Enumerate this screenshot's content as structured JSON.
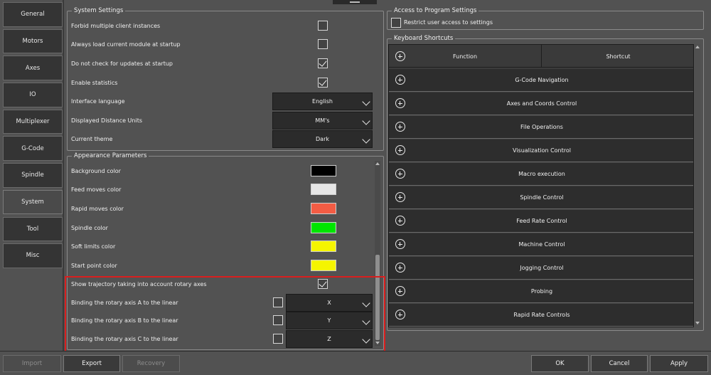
{
  "tabs": [
    "General",
    "Motors",
    "Axes",
    "IO",
    "Multiplexer",
    "G-Code",
    "Spindle",
    "System",
    "Tool",
    "Misc"
  ],
  "active_tab": "System",
  "system_settings": {
    "title": "System Settings",
    "rows": [
      {
        "label": "Forbid multiple client instances",
        "type": "checkbox",
        "checked": false
      },
      {
        "label": "Always load current module at startup",
        "type": "checkbox",
        "checked": false
      },
      {
        "label": "Do not check for updates at startup",
        "type": "checkbox",
        "checked": true
      },
      {
        "label": "Enable statistics",
        "type": "checkbox",
        "checked": true
      },
      {
        "label": "Interface language",
        "type": "select",
        "value": "English"
      },
      {
        "label": "Displayed Distance Units",
        "type": "select",
        "value": "MM's"
      },
      {
        "label": "Current theme",
        "type": "select",
        "value": "Dark"
      }
    ]
  },
  "appearance": {
    "title": "Appearance Parameters",
    "colors": [
      {
        "label": "Background color",
        "color": "#000000"
      },
      {
        "label": "Feed moves color",
        "color": "#e6e6e6"
      },
      {
        "label": "Rapid moves color",
        "color": "#f35c44"
      },
      {
        "label": "Spindle color",
        "color": "#00e600"
      },
      {
        "label": "Soft limits color",
        "color": "#f5f500"
      },
      {
        "label": "Start point color",
        "color": "#f5f500"
      }
    ],
    "show_trajectory": {
      "label": "Show trajectory taking into account rotary axes",
      "checked": true
    },
    "bindings": [
      {
        "label": "Binding the rotary axis A to the linear",
        "checked": false,
        "value": "X"
      },
      {
        "label": "Binding the rotary axis B to the linear",
        "checked": false,
        "value": "Y"
      },
      {
        "label": "Binding the rotary axis C to the linear",
        "checked": false,
        "value": "Z"
      }
    ]
  },
  "access": {
    "title": "Access to Program Settings",
    "restrict_label": "Restrict user access to settings",
    "restrict_checked": false
  },
  "shortcuts": {
    "title": "Keyboard Shortcuts",
    "col_function": "Function",
    "col_shortcut": "Shortcut",
    "groups": [
      "G-Code Navigation",
      "Axes and Coords Control",
      "File Operations",
      "Visualization Control",
      "Macro execution",
      "Spindle Control",
      "Feed Rate Control",
      "Machine Control",
      "Jogging Control",
      "Probing",
      "Rapid Rate Controls"
    ]
  },
  "buttons": {
    "import": "Import",
    "export": "Export",
    "recovery": "Recovery",
    "ok": "OK",
    "cancel": "Cancel",
    "apply": "Apply"
  },
  "colors": {
    "background": "#525252",
    "highlight": "#d91e1e",
    "control_dark": "#2b2b2b"
  }
}
